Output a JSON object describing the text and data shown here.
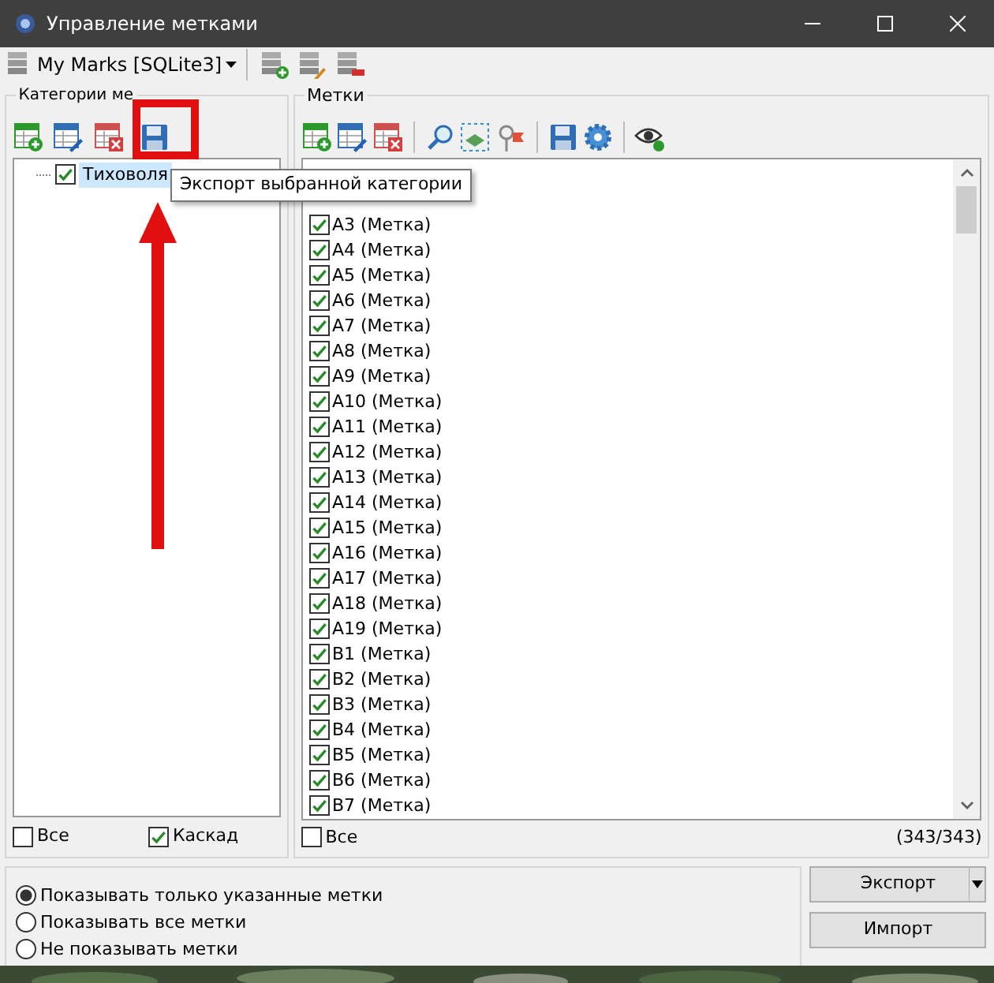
{
  "window": {
    "title": "Управление метками"
  },
  "database": {
    "label": "My Marks [SQLite3]"
  },
  "categories": {
    "title": "Категории ме",
    "tree": [
      {
        "label": "Тиховоля",
        "checked": true,
        "selected": true
      }
    ],
    "all": {
      "label": "Все",
      "checked": false
    },
    "cascade": {
      "label": "Каскад",
      "checked": true
    }
  },
  "tooltip": "Экспорт выбранной категории",
  "marks": {
    "title": "Метки",
    "items": [
      {
        "label": "A3 (Метка)",
        "checked": true
      },
      {
        "label": "A4 (Метка)",
        "checked": true
      },
      {
        "label": "A5 (Метка)",
        "checked": true
      },
      {
        "label": "A6 (Метка)",
        "checked": true
      },
      {
        "label": "A7 (Метка)",
        "checked": true
      },
      {
        "label": "A8 (Метка)",
        "checked": true
      },
      {
        "label": "A9 (Метка)",
        "checked": true
      },
      {
        "label": "A10 (Метка)",
        "checked": true
      },
      {
        "label": "A11 (Метка)",
        "checked": true
      },
      {
        "label": "A12 (Метка)",
        "checked": true
      },
      {
        "label": "A13 (Метка)",
        "checked": true
      },
      {
        "label": "A14 (Метка)",
        "checked": true
      },
      {
        "label": "A15 (Метка)",
        "checked": true
      },
      {
        "label": "A16 (Метка)",
        "checked": true
      },
      {
        "label": "A17 (Метка)",
        "checked": true
      },
      {
        "label": "A18 (Метка)",
        "checked": true
      },
      {
        "label": "A19 (Метка)",
        "checked": true
      },
      {
        "label": "B1 (Метка)",
        "checked": true
      },
      {
        "label": "B2 (Метка)",
        "checked": true
      },
      {
        "label": "B3 (Метка)",
        "checked": true
      },
      {
        "label": "B4 (Метка)",
        "checked": true
      },
      {
        "label": "B5 (Метка)",
        "checked": true
      },
      {
        "label": "B6 (Метка)",
        "checked": true
      },
      {
        "label": "B7 (Метка)",
        "checked": true
      }
    ],
    "all": {
      "label": "Все",
      "checked": false
    },
    "count": "(343/343)"
  },
  "display_mode": [
    {
      "label": "Показывать только указанные метки",
      "selected": true
    },
    {
      "label": "Показывать все метки",
      "selected": false
    },
    {
      "label": "Не показывать метки",
      "selected": false
    }
  ],
  "buttons": [
    {
      "label": "Экспорт",
      "kind": "split"
    },
    {
      "label": "Импорт",
      "kind": "plain"
    }
  ]
}
